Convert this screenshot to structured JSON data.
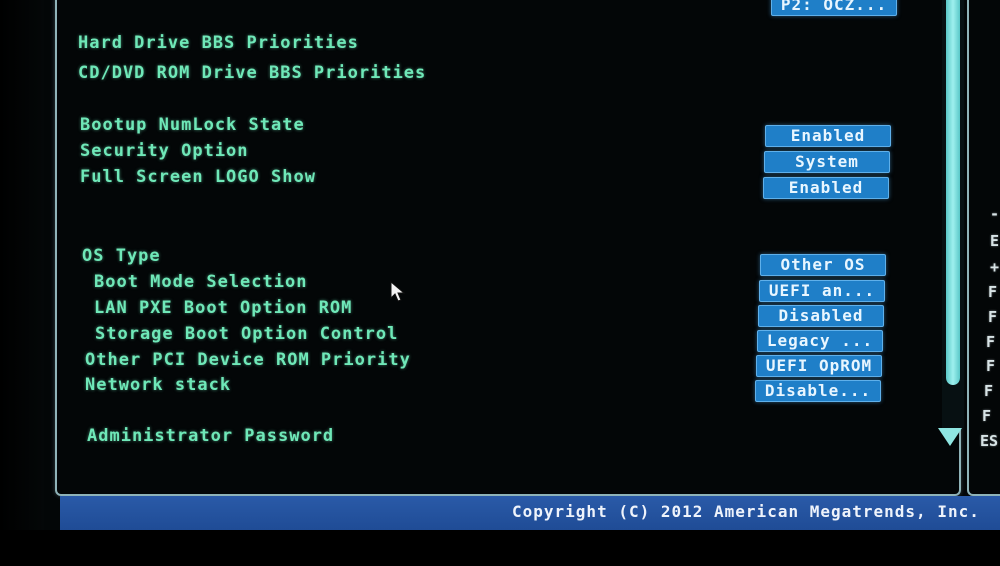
{
  "top_value": "P2: OCZ...",
  "boot_priorities": [
    "Hard Drive BBS Priorities",
    "CD/DVD ROM Drive BBS Priorities"
  ],
  "settings": [
    {
      "label": "Bootup NumLock State",
      "value": "Enabled"
    },
    {
      "label": "Security Option",
      "value": "System"
    },
    {
      "label": "Full Screen LOGO Show",
      "value": "Enabled"
    }
  ],
  "os_settings": [
    {
      "label": "OS Type",
      "value": "Other OS"
    },
    {
      "label": "Boot Mode Selection",
      "value": "UEFI an..."
    },
    {
      "label": "LAN PXE Boot Option ROM",
      "value": "Disabled"
    },
    {
      "label": "Storage Boot Option Control",
      "value": "Legacy ..."
    },
    {
      "label": "Other PCI Device ROM Priority",
      "value": "UEFI OpROM"
    },
    {
      "label": "Network stack",
      "value": "Disable..."
    }
  ],
  "admin_password_label": "Administrator Password",
  "hotkeys": [
    "-",
    "E",
    "+",
    "F",
    "F",
    "F",
    "F",
    "F",
    "F",
    "ES"
  ],
  "footer": {
    "copyright": "Copyright (C) 2012 American Megatrends, Inc."
  },
  "colors": {
    "item_text": "#6fe8b8",
    "value_bg": "#1f7fc8",
    "footer_bg": "#2a5aa8"
  }
}
